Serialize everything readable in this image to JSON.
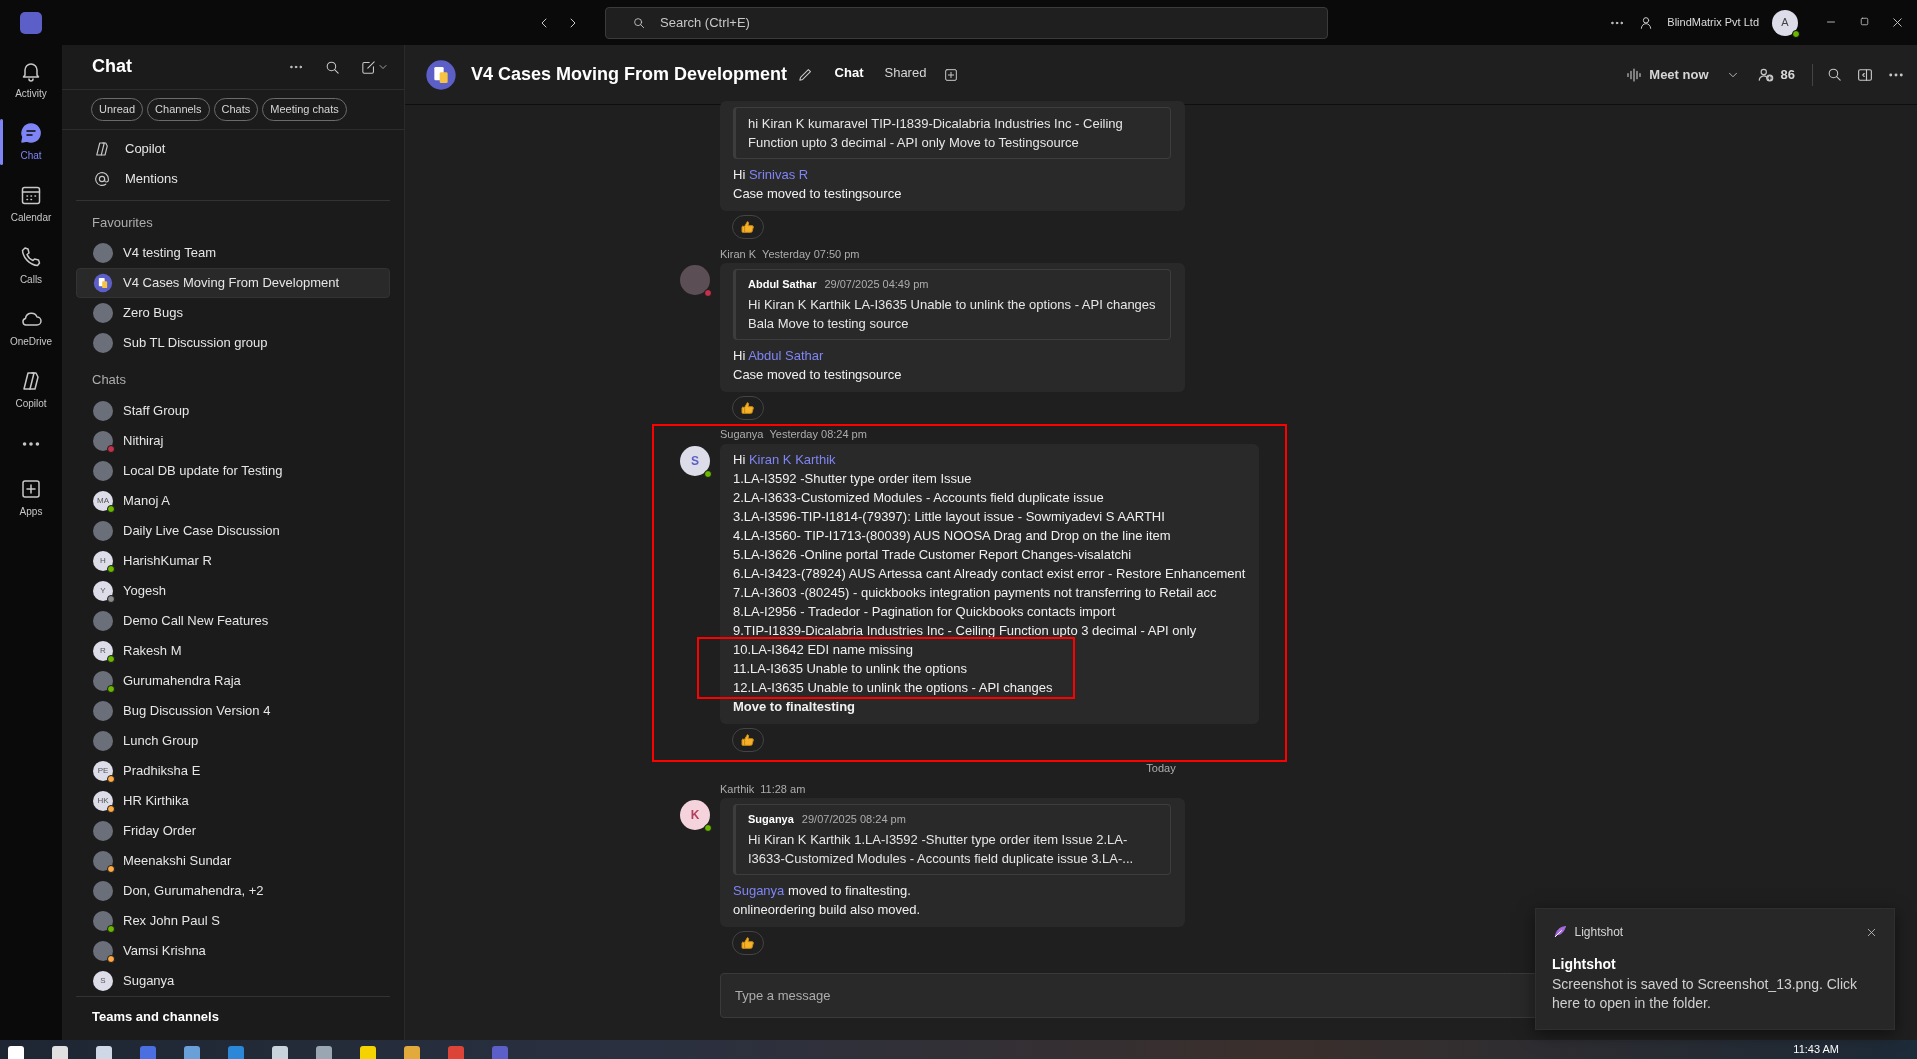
{
  "titlebar": {
    "search": {
      "placeholder": "Search (Ctrl+E)"
    },
    "org": "BlindMatrix Pvt Ltd",
    "avatar": {
      "initials": "A",
      "color": "#6bb700"
    }
  },
  "rail": [
    {
      "kind": "app",
      "label": "Activity",
      "selected": false
    },
    {
      "kind": "app",
      "label": "Chat",
      "selected": true
    },
    {
      "kind": "app",
      "label": "Calendar",
      "selected": false
    },
    {
      "kind": "app",
      "label": "Calls",
      "selected": false
    },
    {
      "kind": "app",
      "label": "OneDrive",
      "selected": false
    },
    {
      "kind": "app",
      "label": "Copilot",
      "selected": false
    },
    {
      "kind": "more"
    },
    {
      "kind": "app",
      "label": "Apps",
      "selected": false
    }
  ],
  "sidebar": {
    "title": "Chat",
    "filters": [
      "Unread",
      "Channels",
      "Chats",
      "Meeting chats"
    ],
    "pinned": [
      {
        "label": "Copilot"
      },
      {
        "label": "Mentions"
      }
    ],
    "sections": [
      {
        "heading": "Favourites",
        "items": [
          {
            "label": "V4 testing Team",
            "selected": false
          },
          {
            "label": "V4 Cases Moving From Development",
            "selected": true
          },
          {
            "label": "Zero Bugs",
            "selected": false
          },
          {
            "label": "Sub TL Discussion group",
            "selected": false
          }
        ]
      },
      {
        "heading": "Chats",
        "items": [
          {
            "label": "Staff Group",
            "selected": false
          },
          {
            "label": "Nithiraj",
            "selected": false,
            "color": "#c4314b"
          },
          {
            "label": "Local DB update for Testing",
            "selected": false
          },
          {
            "label": "Manoj A",
            "selected": false,
            "initials": "MA",
            "color": "#6bb700"
          },
          {
            "label": "Daily Live Case Discussion",
            "selected": false
          },
          {
            "label": "HarishKumar R",
            "selected": false,
            "initials": "H",
            "color": "#6bb700"
          },
          {
            "label": "Yogesh",
            "selected": false,
            "initials": "Y",
            "color": "#8a8a8a"
          },
          {
            "label": "Demo Call New Features",
            "selected": false
          },
          {
            "label": "Rakesh M",
            "selected": false,
            "initials": "R",
            "color": "#6bb700"
          },
          {
            "label": "Gurumahendra Raja",
            "selected": false,
            "color": "#6bb700"
          },
          {
            "label": "Bug Discussion Version 4",
            "selected": false
          },
          {
            "label": "Lunch Group",
            "selected": false
          },
          {
            "label": "Pradhiksha E",
            "selected": false,
            "initials": "PE",
            "color": "#ffaa44"
          },
          {
            "label": "HR Kirthika",
            "selected": false,
            "initials": "HK",
            "color": "#ffaa44"
          },
          {
            "label": "Friday Order",
            "selected": false
          },
          {
            "label": "Meenakshi Sundar",
            "selected": false,
            "color": "#ffaa44"
          },
          {
            "label": "Don, Gurumahendra, +2",
            "selected": false
          },
          {
            "label": "Rex John Paul S",
            "selected": false,
            "color": "#6bb700"
          },
          {
            "label": "Vamsi Krishna",
            "selected": false,
            "color": "#ffaa44"
          },
          {
            "label": "Suganya",
            "selected": false,
            "initials": "S"
          }
        ]
      }
    ],
    "footer": "Teams and channels"
  },
  "conversation": {
    "title": "V4 Cases Moving From Development",
    "tabs": [
      {
        "label": "Chat",
        "selected": true
      },
      {
        "label": "Shared",
        "selected": false
      }
    ],
    "meet": "Meet now",
    "participants": "86",
    "messages": [
      {
        "kind": "message",
        "quote": {
          "text": "hi Kiran K kumaravel TIP-I1839-Dicalabria Industries Inc - Ceiling Function upto 3 decimal - API only Move to Testingsource"
        },
        "lines": [
          [
            {
              "text": "Hi "
            },
            {
              "text": "Srinivas R",
              "mention": true
            }
          ],
          [
            {
              "text": "Case moved to testingsource"
            }
          ]
        ],
        "reacted": true
      },
      {
        "kind": "message",
        "sender": "Kiran K",
        "time": "Yesterday 07:50 pm",
        "avatar": {
          "color": "#c4314b"
        },
        "quote": {
          "author": "Abdul Sathar",
          "time": "29/07/2025 04:49 pm",
          "text": "Hi Kiran K Karthik LA-I3635 Unable to unlink the options - API changes Bala Move to testing source"
        },
        "lines": [
          [
            {
              "text": "Hi "
            },
            {
              "text": "Abdul Sathar",
              "mention": true
            }
          ],
          [
            {
              "text": "Case moved to testingsource"
            }
          ]
        ],
        "reacted": true
      },
      {
        "kind": "message",
        "sender": "Suganya",
        "time": "Yesterday 08:24 pm",
        "avatar": {
          "initials": "S",
          "color": "#6bb700"
        },
        "outlined": true,
        "lines": [
          [
            {
              "text": "Hi "
            },
            {
              "text": "Kiran K Karthik",
              "mention": true
            }
          ],
          [
            {
              "text": "1.LA-I3592 -Shutter type order item Issue"
            }
          ],
          [
            {
              "text": "2.LA-I3633-Customized Modules - Accounts field duplicate issue"
            }
          ],
          [
            {
              "text": "3.LA-I3596-TIP-I1814-(79397): Little layout issue - Sowmiyadevi S AARTHI"
            }
          ],
          [
            {
              "text": "4.LA-I3560- TIP-I1713-(80039) AUS NOOSA Drag and Drop on the line item"
            }
          ],
          [
            {
              "text": "5.LA-I3626 -Online portal Trade Customer Report Changes-visalatchi"
            }
          ],
          [
            {
              "text": "6.LA-I3423-(78924) AUS Artessa cant Already contact exist error - Restore Enhancement"
            }
          ],
          [
            {
              "text": "7.LA-I3603 -(80245) - quickbooks integration payments not transferring to Retail acc"
            }
          ],
          [
            {
              "text": "8.LA-I2956 - Tradedor - Pagination for Quickbooks contacts import"
            }
          ],
          [
            {
              "text": "9.TIP-I1839-Dicalabria Industries Inc - Ceiling Function upto 3 decimal - API only"
            }
          ],
          [
            {
              "text": "10.LA-I3642 EDI name missing",
              "outlined": true
            }
          ],
          [
            {
              "text": "11.LA-I3635 Unable to unlink the options",
              "outlined": true
            }
          ],
          [
            {
              "text": "12.LA-I3635 Unable to unlink the options - API changes",
              "outlined": true
            }
          ],
          [
            {
              "text": "Move to finaltesting",
              "bold": true
            }
          ]
        ],
        "reacted": true
      },
      {
        "kind": "divider",
        "label": "Today"
      },
      {
        "kind": "message",
        "sender": "Karthik",
        "time": "11:28 am",
        "avatar": {
          "initials": "K",
          "color": "#6bb700"
        },
        "quote": {
          "author": "Suganya",
          "time": "29/07/2025 08:24 pm",
          "text": "Hi Kiran K Karthik 1.LA-I3592 -Shutter type order item Issue 2.LA-I3633-Customized Modules - Accounts field duplicate issue 3.LA-..."
        },
        "lines": [
          [
            {
              "text": "Suganya",
              "mention": true
            },
            {
              "text": " moved to finaltesting."
            }
          ],
          [
            {
              "text": "onlineordering build also moved."
            }
          ]
        ],
        "reacted": true
      }
    ],
    "compose": {
      "placeholder": "Type a message"
    }
  },
  "toast": {
    "app": "Lightshot",
    "title": "Lightshot",
    "body": "Screenshot is saved to Screenshot_13.png. Click here to open in the folder."
  },
  "taskbar": {
    "clock": "11:43 AM"
  }
}
